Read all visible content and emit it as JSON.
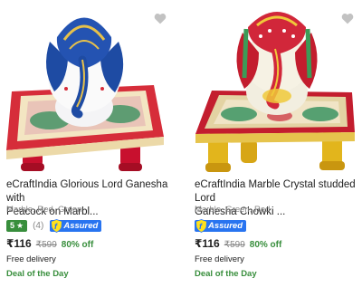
{
  "colors": {
    "rating_green": "#388e3c",
    "assured_blue": "#2874f0",
    "muted_gray": "#878787",
    "wishlist_gray": "#c2c2c2"
  },
  "products": [
    {
      "title_line1": "eCraftIndia Glorious Lord Ganesha with",
      "title_line2": "Peacock on Marbl...",
      "colors_text": "Marble, Red, Green",
      "rating": "5",
      "rating_star": "★",
      "rating_count": "(4)",
      "assured_label": "Assured",
      "price": "₹116",
      "mrp": "₹599",
      "discount": "80% off",
      "delivery": "Free delivery",
      "deal": "Deal of the Day",
      "wishlist_icon": "heart-icon",
      "image_theme": "blue-white-ganesha-red-chowki"
    },
    {
      "title_line1": "eCraftIndia Marble Crystal studded Lord",
      "title_line2": "Ganesha Chowki ...",
      "colors_text": "Marble, Green, Red",
      "assured_label": "Assured",
      "price": "₹116",
      "mrp": "₹599",
      "discount": "80% off",
      "delivery": "Free delivery",
      "deal": "Deal of the Day",
      "wishlist_icon": "heart-icon",
      "image_theme": "red-yellow-ganesha-gold-chowki"
    }
  ]
}
